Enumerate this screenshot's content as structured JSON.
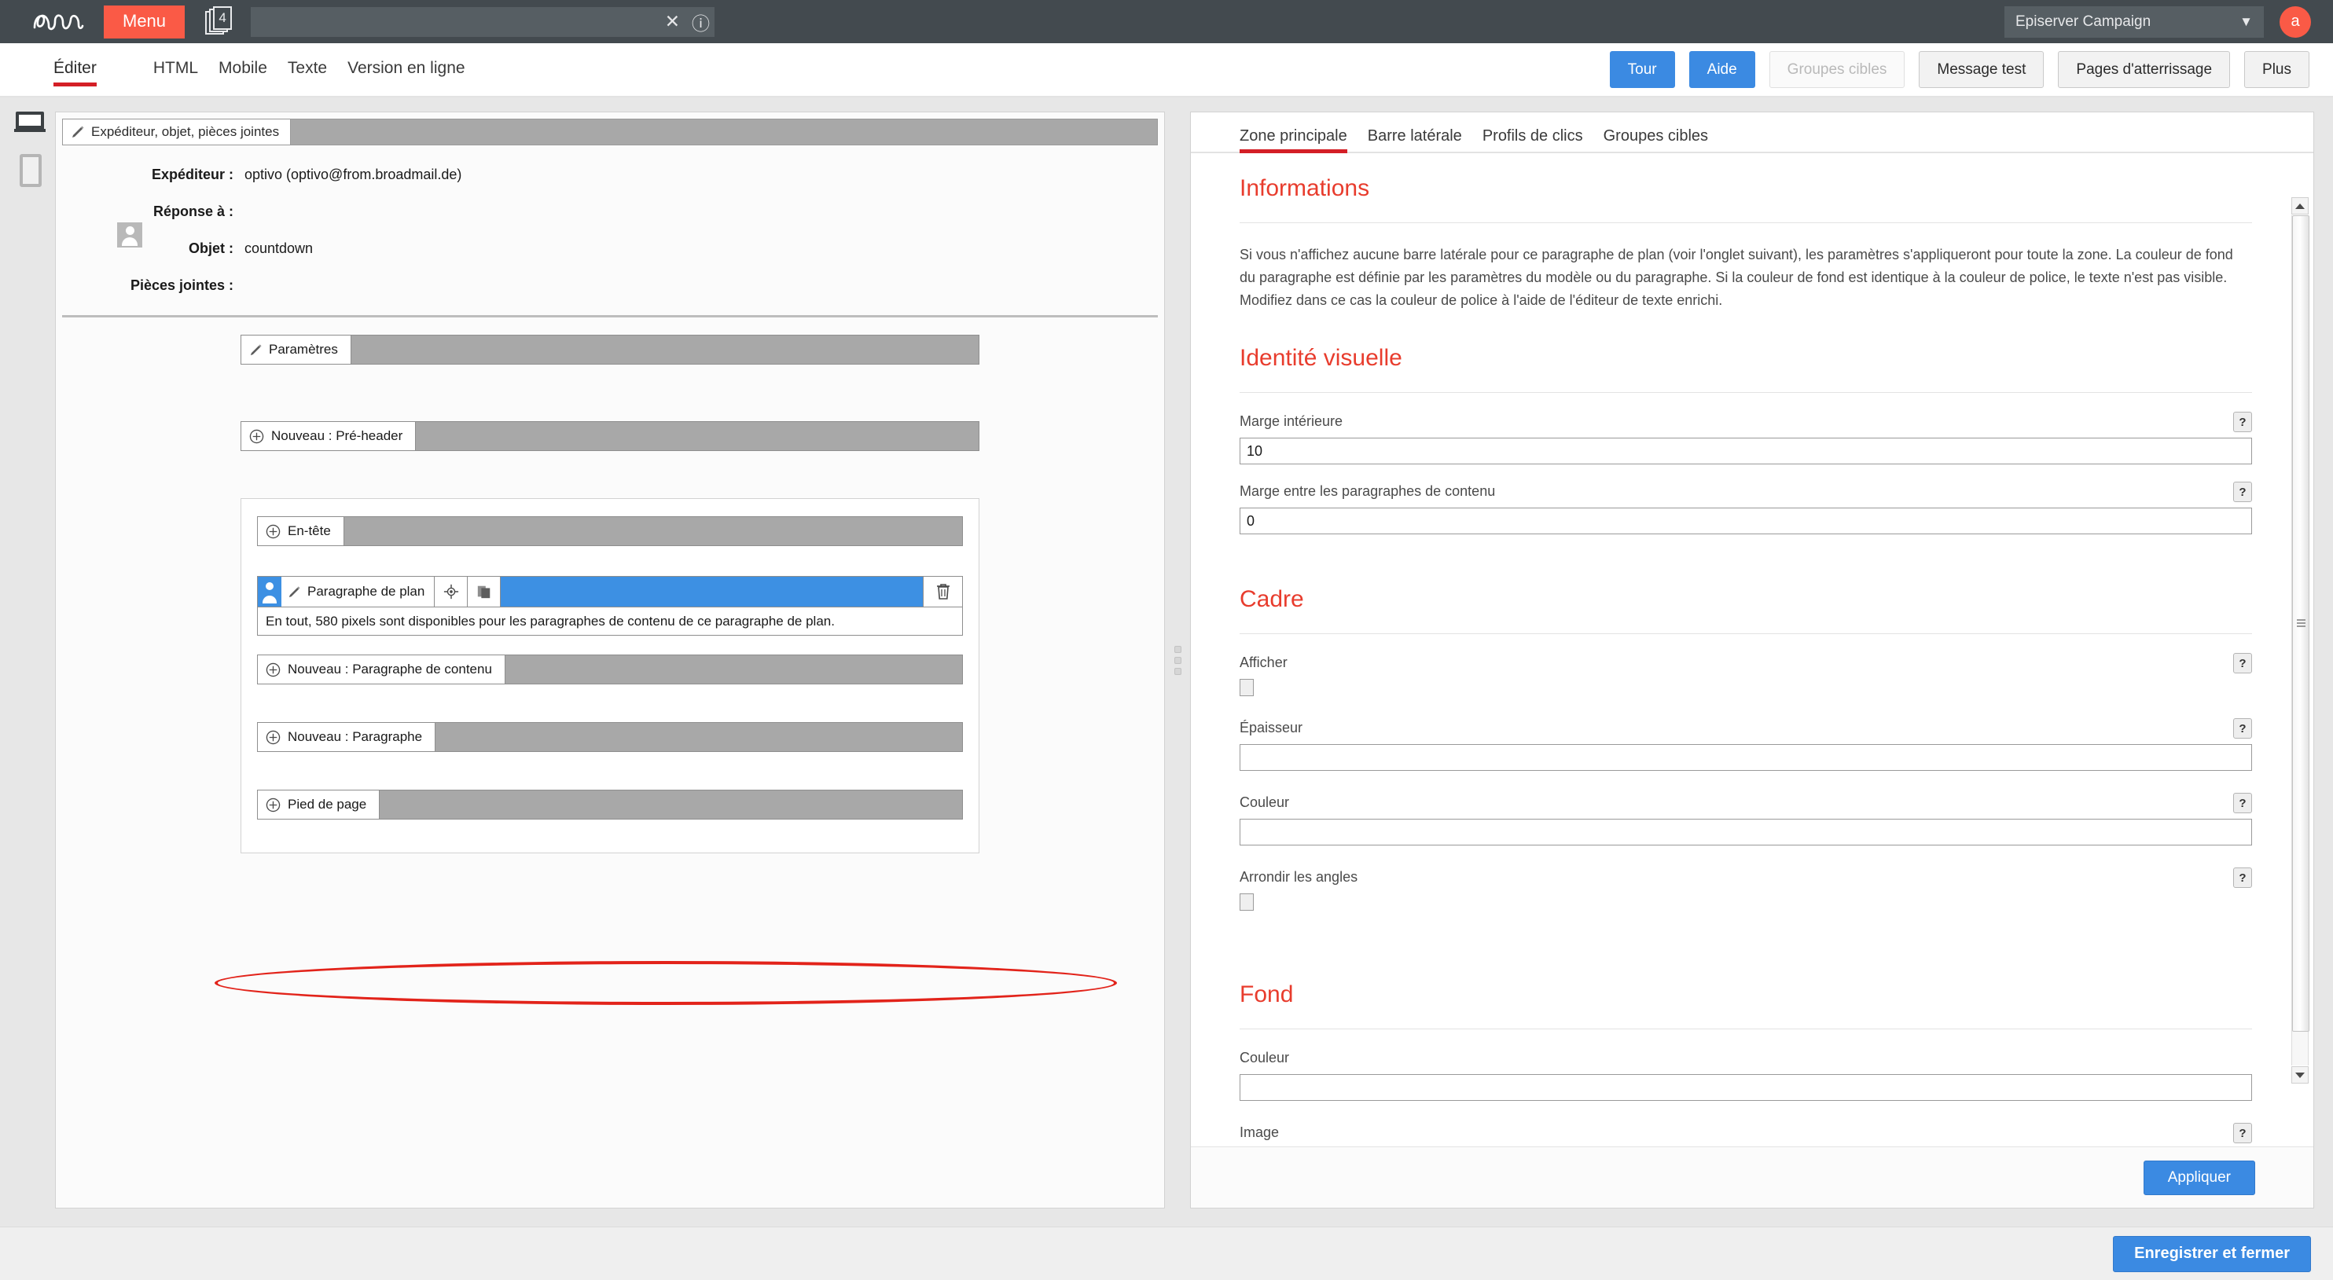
{
  "topbar": {
    "logo": "epi-logo",
    "menu_label": "Menu",
    "doc_count": "4",
    "search_value": "",
    "search_placeholder": "",
    "clear_icon": "close-icon",
    "help_icon": "question-circle-icon",
    "client_name": "Episerver Campaign",
    "chevron": "⌄",
    "avatar_initial": "a"
  },
  "toolbar": {
    "tabs": [
      {
        "label": "Éditer",
        "active": true
      },
      {
        "label": "HTML",
        "active": false
      },
      {
        "label": "Mobile",
        "active": false
      },
      {
        "label": "Texte",
        "active": false
      },
      {
        "label": "Version en ligne",
        "active": false
      }
    ],
    "buttons": [
      {
        "label": "Tour",
        "style": "blue"
      },
      {
        "label": "Aide",
        "style": "blue"
      },
      {
        "label": "Groupes cibles",
        "style": "disabled"
      },
      {
        "label": "Message test",
        "style": "grey"
      },
      {
        "label": "Pages d'atterrissage",
        "style": "grey"
      },
      {
        "label": "Plus",
        "style": "grey"
      }
    ]
  },
  "device_rail": {
    "desktop_icon": "laptop-icon",
    "mobile_icon": "tablet-icon"
  },
  "editor": {
    "header_tab_label": "Expéditeur, objet, pièces jointes",
    "fields": [
      {
        "label": "Expéditeur :",
        "value": "optivo (optivo@from.broadmail.de)"
      },
      {
        "label": "Réponse à :",
        "value": ""
      },
      {
        "label": "Objet :",
        "value": "countdown"
      },
      {
        "label": "Pièces jointes :",
        "value": ""
      }
    ],
    "blocks": {
      "parametres": "Paramètres",
      "preheader": "Nouveau : Pré-header",
      "entete": "En-tête",
      "plan_paragraph": "Paragraphe de plan",
      "plan_note": "En tout, 580 pixels sont disponibles pour les paragraphes de contenu de ce paragraphe de plan.",
      "nouveau_contenu": "Nouveau : Paragraphe de contenu",
      "nouveau_paragraphe": "Nouveau : Paragraphe",
      "pied_de_page": "Pied de page"
    },
    "icons": {
      "brush": "brush-icon",
      "plus": "plus-circle-icon",
      "target": "target-icon",
      "copy": "copy-icon",
      "trash": "trash-icon",
      "avatar": "person-icon"
    }
  },
  "properties": {
    "tabs": [
      {
        "label": "Zone principale",
        "active": true
      },
      {
        "label": "Barre latérale",
        "active": false
      },
      {
        "label": "Profils de clics",
        "active": false
      },
      {
        "label": "Groupes cibles",
        "active": false
      }
    ],
    "sections": {
      "informations": {
        "title": "Informations",
        "text": "Si vous n'affichez aucune barre latérale pour ce paragraphe de plan (voir l'onglet suivant), les paramètres s'appliqueront pour toute la zone. La couleur de fond du paragraphe est définie par les paramètres du modèle ou du paragraphe. Si la couleur de fond est identique à la couleur de police, le texte n'est pas visible. Modifiez dans ce cas la couleur de police à l'aide de l'éditeur de texte enrichi."
      },
      "identite": {
        "title": "Identité visuelle",
        "fields": [
          {
            "label": "Marge intérieure",
            "value": "10",
            "type": "text",
            "help": "?"
          },
          {
            "label": "Marge entre les paragraphes de contenu",
            "value": "0",
            "type": "text",
            "help": "?"
          }
        ]
      },
      "cadre": {
        "title": "Cadre",
        "fields": [
          {
            "label": "Afficher",
            "value": "",
            "type": "checkbox",
            "checked": false,
            "help": "?"
          },
          {
            "label": "Épaisseur",
            "value": "",
            "type": "text",
            "help": "?"
          },
          {
            "label": "Couleur",
            "value": "",
            "type": "text",
            "help": "?"
          },
          {
            "label": "Arrondir les angles",
            "value": "",
            "type": "checkbox",
            "checked": false,
            "help": "?"
          }
        ]
      },
      "fond": {
        "title": "Fond",
        "fields": [
          {
            "label": "Couleur",
            "value": "",
            "type": "text",
            "help": ""
          },
          {
            "label": "Image",
            "value": "",
            "type": "label-only",
            "help": "?"
          }
        ]
      }
    },
    "apply_label": "Appliquer"
  },
  "footer": {
    "save_label": "Enregistrer et fermer"
  },
  "colors": {
    "topbar_bg": "#434a4f",
    "accent_orange": "#fa5a46",
    "accent_red": "#d41f26",
    "section_red": "#e83c2d",
    "primary_blue": "#3b8ae2",
    "selection_blue": "#3d90e3",
    "block_grey": "#a8a8a8",
    "annotation_red": "#e2231a"
  }
}
